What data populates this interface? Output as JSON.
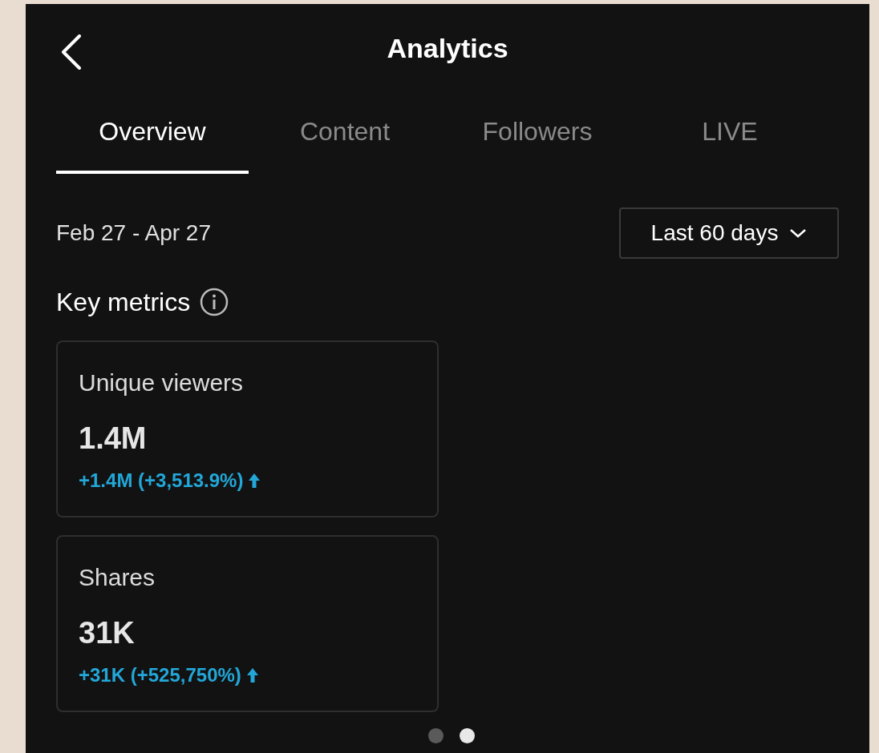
{
  "header": {
    "title": "Analytics"
  },
  "tabs": [
    {
      "label": "Overview",
      "selected": true
    },
    {
      "label": "Content",
      "selected": false
    },
    {
      "label": "Followers",
      "selected": false
    },
    {
      "label": "LIVE",
      "selected": false
    }
  ],
  "date_range": "Feb 27 - Apr 27",
  "period_select": {
    "value": "Last 60 days"
  },
  "section_title": "Key metrics",
  "metrics": [
    {
      "label": "Unique viewers",
      "value": "1.4M",
      "change": "+1.4M (+3,513.9%)",
      "kind": "increase"
    },
    {
      "label": "Shares",
      "value": "31K",
      "change": "+31K (+525,750%)",
      "kind": "increase"
    }
  ],
  "pager": [
    {
      "selected": false
    },
    {
      "selected": true
    }
  ]
}
